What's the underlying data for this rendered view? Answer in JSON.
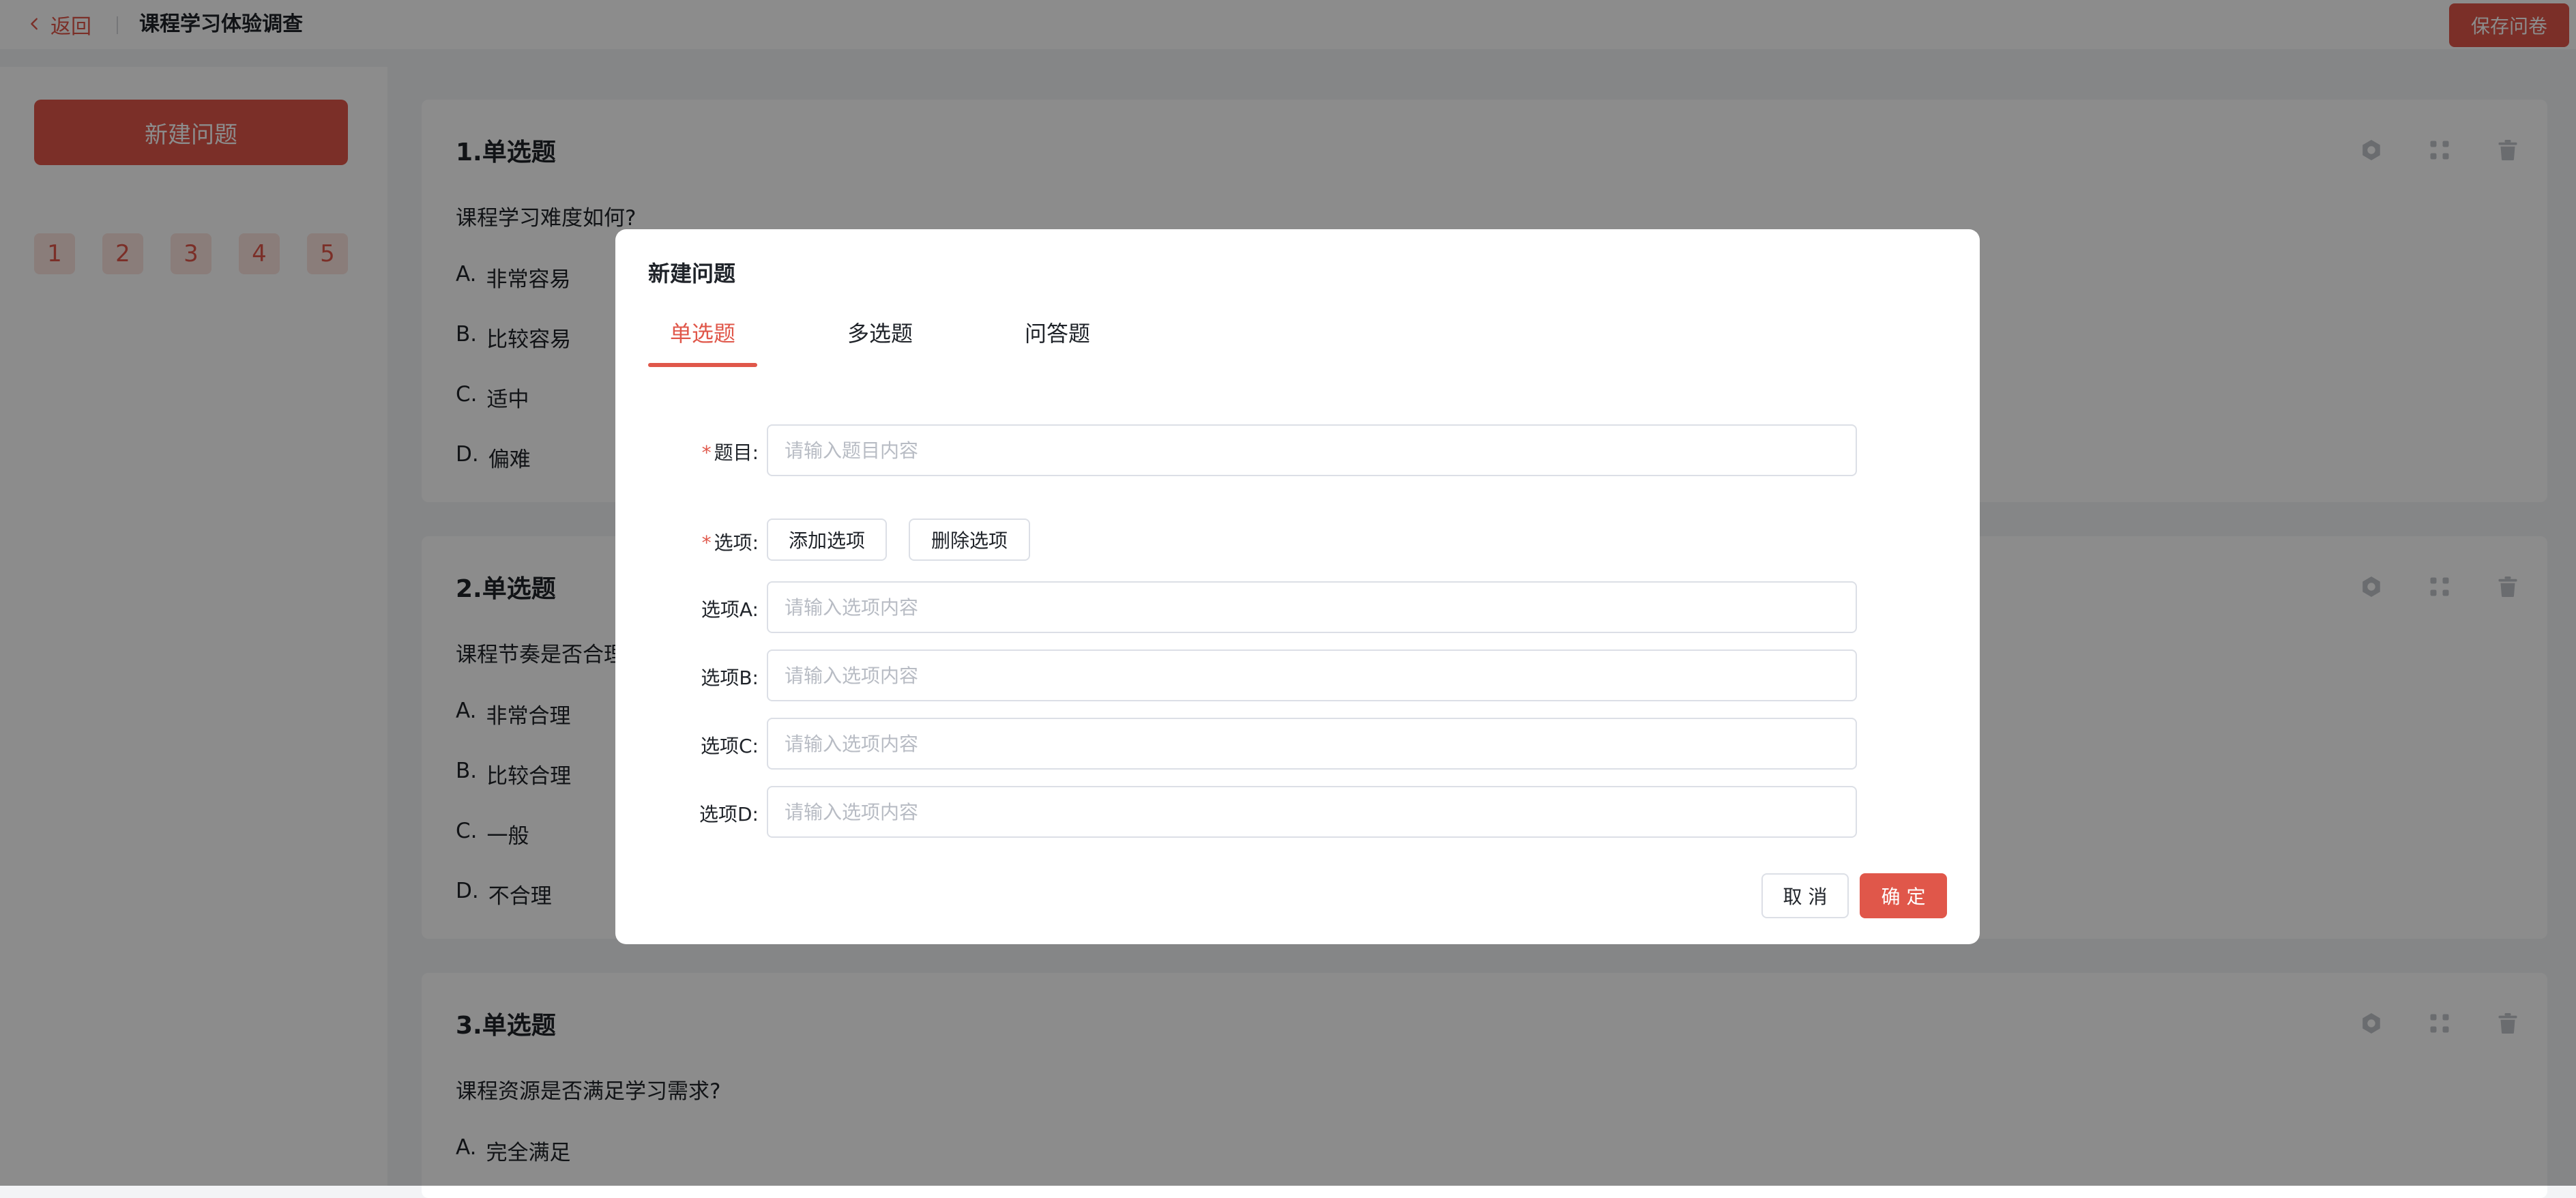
{
  "colors": {
    "accent": "#e0574a",
    "chip_bg": "#fbe3df",
    "page_bg": "#f3f4f6"
  },
  "header": {
    "back_label": "返回",
    "title": "课程学习体验调查",
    "save_label": "保存问卷"
  },
  "sidebar": {
    "new_question_label": "新建问题",
    "numbers": [
      "1",
      "2",
      "3",
      "4",
      "5"
    ]
  },
  "questions": [
    {
      "title": "1.单选题",
      "text": "课程学习难度如何?",
      "options": [
        {
          "letter": "A.",
          "text": "非常容易"
        },
        {
          "letter": "B.",
          "text": "比较容易"
        },
        {
          "letter": "C.",
          "text": "适中"
        },
        {
          "letter": "D.",
          "text": "偏难"
        }
      ]
    },
    {
      "title": "2.单选题",
      "text": "课程节奏是否合理",
      "options": [
        {
          "letter": "A.",
          "text": "非常合理"
        },
        {
          "letter": "B.",
          "text": "比较合理"
        },
        {
          "letter": "C.",
          "text": "一般"
        },
        {
          "letter": "D.",
          "text": "不合理"
        }
      ]
    },
    {
      "title": "3.单选题",
      "text": "课程资源是否满足学习需求?",
      "options": [
        {
          "letter": "A.",
          "text": "完全满足"
        }
      ]
    }
  ],
  "card_icons": [
    "gear-icon",
    "drag-handle-icon",
    "trash-icon"
  ],
  "modal": {
    "title": "新建问题",
    "tabs": [
      "单选题",
      "多选题",
      "问答题"
    ],
    "active_tab": "单选题",
    "topic_label": "题目:",
    "topic_placeholder": "请输入题目内容",
    "options_label": "选项:",
    "add_option_label": "添加选项",
    "delete_option_label": "删除选项",
    "option_fields": [
      {
        "label": "选项A:",
        "placeholder": "请输入选项内容"
      },
      {
        "label": "选项B:",
        "placeholder": "请输入选项内容"
      },
      {
        "label": "选项C:",
        "placeholder": "请输入选项内容"
      },
      {
        "label": "选项D:",
        "placeholder": "请输入选项内容"
      }
    ],
    "cancel_label": "取 消",
    "ok_label": "确 定"
  }
}
